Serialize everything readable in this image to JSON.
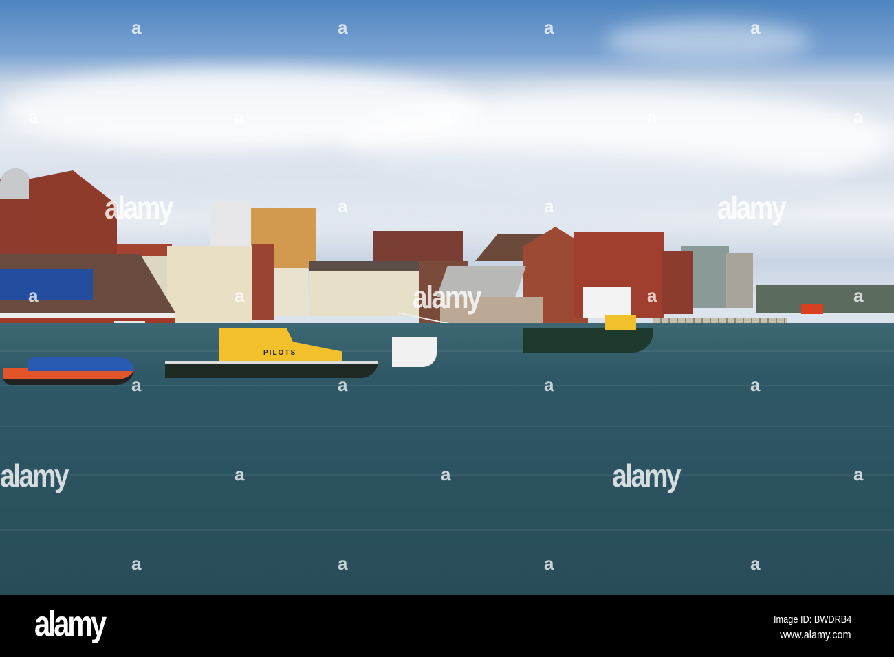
{
  "photo": {
    "boat_lettering": "PILOTS",
    "watermark_small": "a",
    "watermark_large": "alamy"
  },
  "footer": {
    "logo": "alamy",
    "image_id": "Image ID: BWDRB4",
    "url": "www.alamy.com"
  },
  "colors": {
    "sky": "#4f84c0",
    "water": "#2c5260",
    "brick": "#8e3a2c",
    "pilot_boat": "#f2c02a"
  }
}
